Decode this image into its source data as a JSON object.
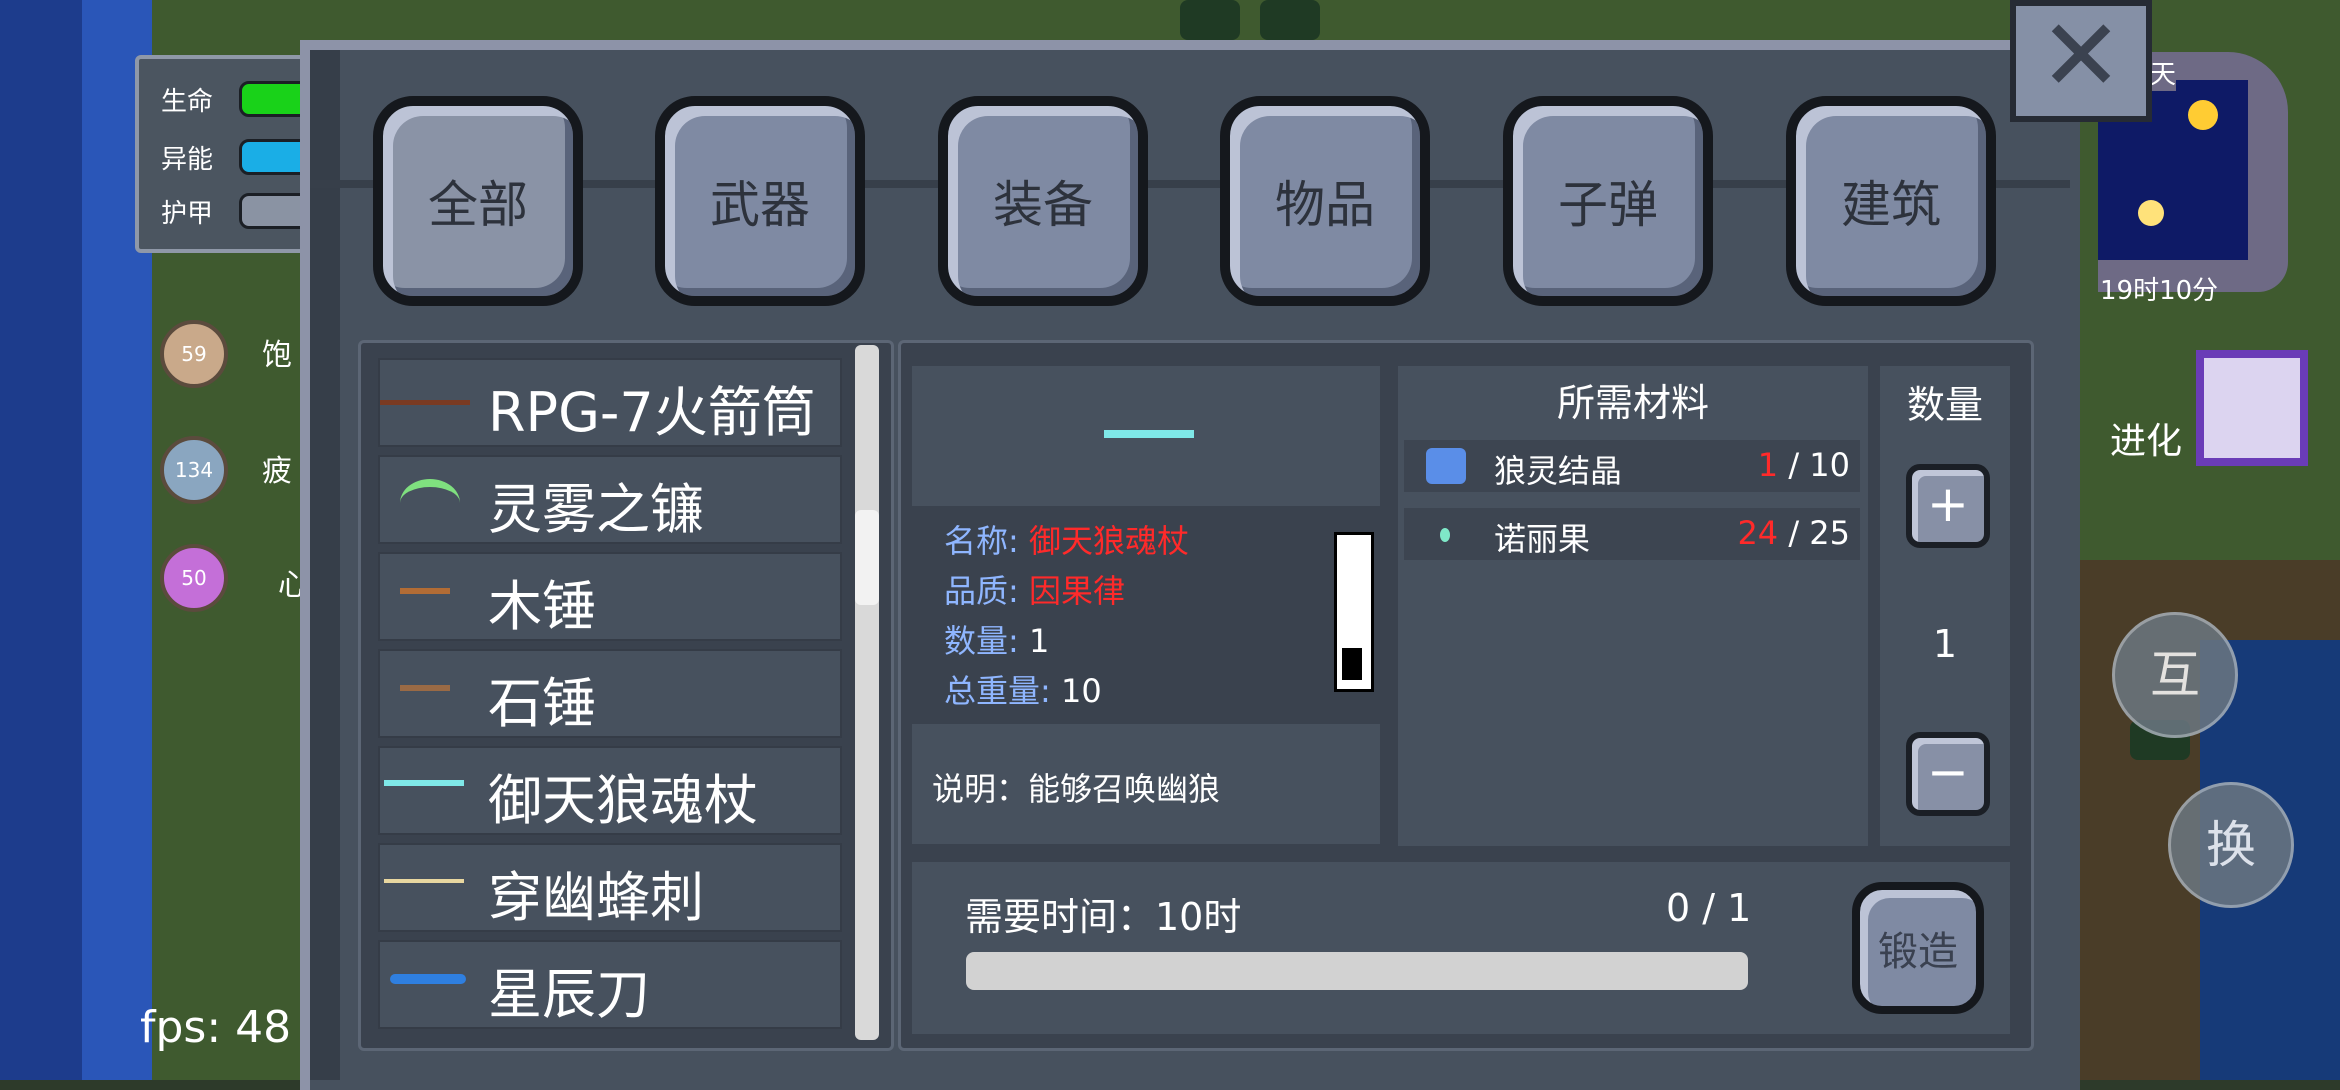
{
  "hud": {
    "stats": [
      {
        "label": "生命",
        "color": "#19d219"
      },
      {
        "label": "异能",
        "color": "#1aaee6"
      },
      {
        "label": "护甲",
        "color": "#8a93a3"
      }
    ],
    "status": [
      {
        "value": "59",
        "label": "饱"
      },
      {
        "value": "134",
        "label": "疲"
      },
      {
        "value": "50",
        "label": "心"
      }
    ],
    "fps": "fps: 48"
  },
  "tabs": [
    "全部",
    "武器",
    "装备",
    "物品",
    "子弹",
    "建筑"
  ],
  "close_icon": "close-icon",
  "items": [
    {
      "name": "RPG-7火箭筒",
      "icon": "rpg-icon"
    },
    {
      "name": "灵雾之镰",
      "icon": "scythe-icon"
    },
    {
      "name": "木锤",
      "icon": "wood-hammer-icon"
    },
    {
      "name": "石锤",
      "icon": "stone-hammer-icon"
    },
    {
      "name": "御天狼魂杖",
      "icon": "staff-icon"
    },
    {
      "name": "穿幽蜂刺",
      "icon": "sting-icon"
    },
    {
      "name": "星辰刀",
      "icon": "blade-icon"
    }
  ],
  "detail": {
    "name_key": "名称:",
    "name_val": "御天狼魂杖",
    "quality_key": "品质:",
    "quality_val": "因果律",
    "count_key": "数量:",
    "count_val": "1",
    "weight_key": "总重量:",
    "weight_val": "10",
    "description": "说明：能够召唤幽狼"
  },
  "materials": {
    "title": "所需材料",
    "rows": [
      {
        "name": "狼灵结晶",
        "have": "1",
        "need": "/ 10"
      },
      {
        "name": "诺丽果",
        "have": "24",
        "need": "/ 25"
      }
    ]
  },
  "quantity": {
    "title": "数量",
    "value": "1",
    "plus": "+",
    "minus": "−"
  },
  "craft": {
    "time_label": "需要时间：10时",
    "count": "0 / 1",
    "button": "锻造",
    "progress": 0
  },
  "right_hud": {
    "day": "天",
    "time": "19时10分",
    "upgrade": "进化",
    "interact": "互",
    "swap": "换"
  }
}
